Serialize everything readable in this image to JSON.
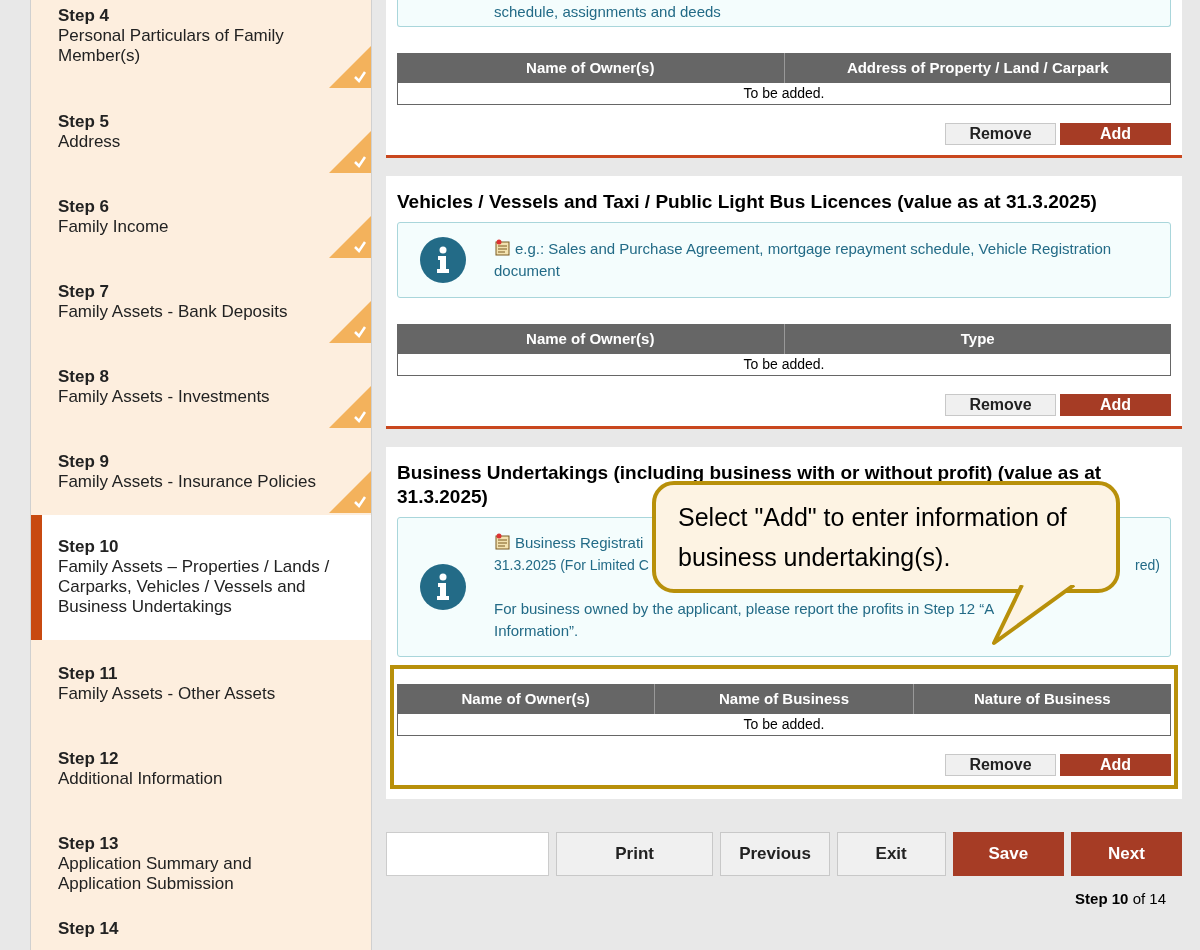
{
  "sidebar": {
    "steps": [
      {
        "step": "Step 4",
        "title": "Personal Particulars of Family Member(s)",
        "completed": true,
        "selected": false
      },
      {
        "step": "Step 5",
        "title": "Address",
        "completed": true,
        "selected": false
      },
      {
        "step": "Step 6",
        "title": "Family Income",
        "completed": true,
        "selected": false
      },
      {
        "step": "Step 7",
        "title": "Family Assets - Bank Deposits",
        "completed": true,
        "selected": false
      },
      {
        "step": "Step 8",
        "title": "Family Assets - Investments",
        "completed": true,
        "selected": false
      },
      {
        "step": "Step 9",
        "title": "Family Assets - Insurance Policies",
        "completed": true,
        "selected": false
      },
      {
        "step": "Step 10",
        "title": "Family Assets – Properties / Lands / Carparks, Vehicles / Vessels and Business Undertakings",
        "completed": false,
        "selected": true
      },
      {
        "step": "Step 11",
        "title": "Family Assets - Other Assets",
        "completed": false,
        "selected": false
      },
      {
        "step": "Step 12",
        "title": "Additional Information",
        "completed": false,
        "selected": false
      },
      {
        "step": "Step 13",
        "title": "Application Summary and Application Submission",
        "completed": false,
        "selected": false
      },
      {
        "step": "Step 14",
        "completed": false,
        "selected": false
      }
    ]
  },
  "sections": [
    {
      "info": {
        "paragraphs": [
          {
            "lines": [
              {
                "left": "schedule, assignments and deeds"
              }
            ]
          }
        ]
      },
      "table": {
        "columns": [
          "Name of Owner(s)",
          "Address of Property / Land / Carpark"
        ],
        "rows": [
          "To be added."
        ]
      },
      "buttons": [
        {
          "label": "Remove",
          "kind": "secondary"
        },
        {
          "label": "Add",
          "kind": "primary"
        }
      ],
      "highlighted": false
    },
    {
      "title": "Vehicles / Vessels and Taxi / Public Light Bus Licences (value as at 31.3.2025)",
      "info": {
        "paragraphs": [
          {
            "document": true,
            "lines": [
              {
                "left": "e.g.: Sales and Purchase Agreement, mortgage repayment schedule, Vehicle Registration document"
              }
            ]
          }
        ]
      },
      "table": {
        "columns": [
          "Name of Owner(s)",
          "Type"
        ],
        "rows": [
          "To be added."
        ]
      },
      "buttons": [
        {
          "label": "Remove",
          "kind": "secondary"
        },
        {
          "label": "Add",
          "kind": "primary"
        }
      ],
      "highlighted": false
    },
    {
      "title": "Business Undertakings (including business with or without profit) (value as at 31.3.2025)",
      "info": {
        "paragraphs": [
          {
            "document": true,
            "lines": [
              {
                "left": "Business Registrati"
              },
              {
                "left": "31.3.2025 (For Limited C",
                "right": "red)"
              }
            ]
          },
          {
            "lines": [
              {
                "left": "For business owned by the applicant, please report the profits in Step 12 “A"
              },
              {
                "left": "Information”."
              }
            ]
          }
        ]
      },
      "table": {
        "columns": [
          "Name of Owner(s)",
          "Name of Business",
          "Nature of Business"
        ],
        "rows": [
          "To be added."
        ]
      },
      "buttons": [
        {
          "label": "Remove",
          "kind": "secondary"
        },
        {
          "label": "Add",
          "kind": "primary"
        }
      ],
      "highlighted": true,
      "callout": "Select \"Add\" to enter information of business undertaking(s)."
    }
  ],
  "nav": {
    "buttons": [
      {
        "label": "Print",
        "kind": "secondary"
      },
      {
        "label": "Previous",
        "kind": "secondary"
      },
      {
        "label": "Exit",
        "kind": "secondary"
      },
      {
        "label": "Save",
        "kind": "primary"
      },
      {
        "label": "Next",
        "kind": "primary"
      }
    ],
    "progress": {
      "current": "Step 10",
      "total": "of 14"
    }
  }
}
